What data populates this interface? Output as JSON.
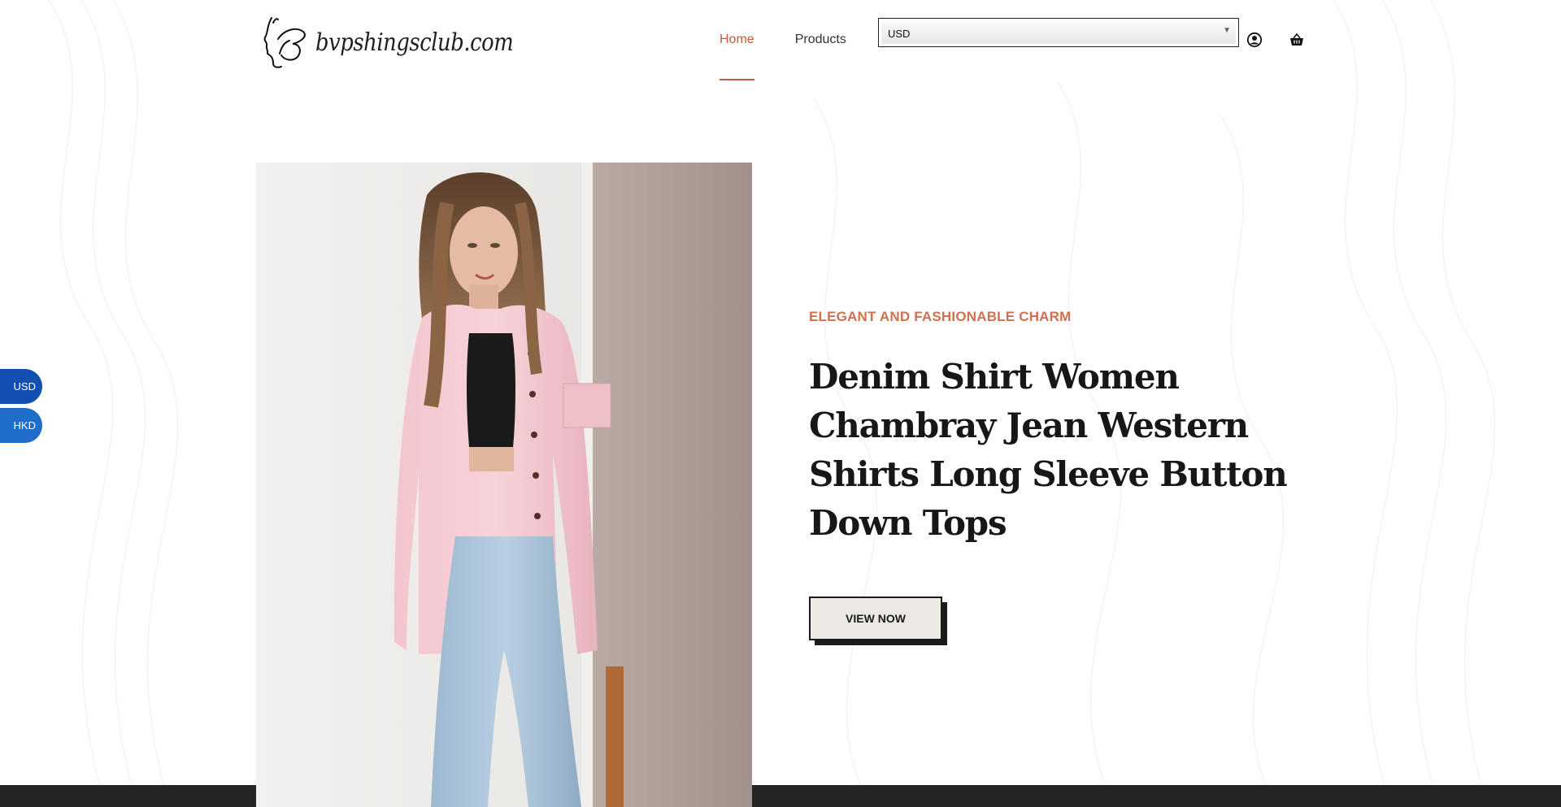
{
  "brand": {
    "name": "bvpshingsclub.com"
  },
  "nav": {
    "items": [
      {
        "label": "Home",
        "active": true
      },
      {
        "label": "Products",
        "active": false
      }
    ]
  },
  "currency_select": {
    "selected": "USD"
  },
  "side_currency": {
    "usd_label": "USD",
    "hkd_label": "HKD"
  },
  "hero": {
    "kicker": "ELEGANT AND FASHIONABLE CHARM",
    "title": "Denim Shirt Women Chambray Jean Western Shirts Long Sleeve Button Down Tops",
    "cta_label": "VIEW NOW"
  },
  "colors": {
    "accent": "#c45a3b",
    "kicker": "#d0704e",
    "side_currency_blue": "#1e5bb8",
    "footer": "#222426"
  },
  "icons": {
    "account": "user-circle-icon",
    "cart": "basket-icon",
    "select_arrow": "triangle-down-icon"
  }
}
